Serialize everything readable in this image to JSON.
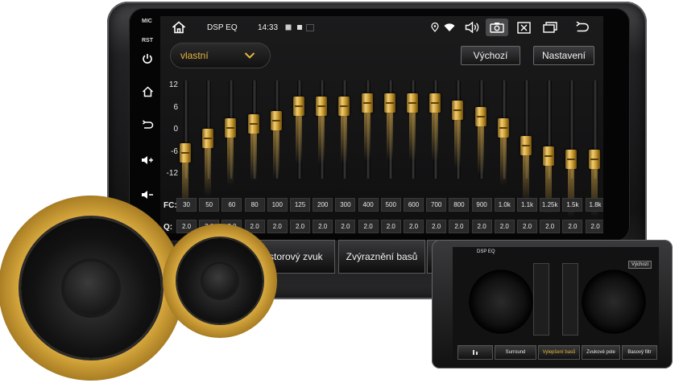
{
  "side_panel": {
    "mic_label": "MIC",
    "rst_label": "RST"
  },
  "statusbar": {
    "title": "DSP EQ",
    "time": "14:33"
  },
  "preset": {
    "label": "vlastní"
  },
  "buttons": {
    "default_label": "Výchozí",
    "settings_label": "Nastavení"
  },
  "eq": {
    "db_labels": [
      "12",
      "6",
      "0",
      "-6",
      "-12"
    ],
    "fc_label": "FC:",
    "q_label": "Q:",
    "frequencies": [
      "30",
      "50",
      "60",
      "80",
      "100",
      "125",
      "200",
      "300",
      "400",
      "500",
      "600",
      "700",
      "800",
      "900",
      "1.0k",
      "1.1k",
      "1.25k",
      "1.5k",
      "1.8k"
    ],
    "q_values": [
      "2.0",
      "2.0",
      "2.0",
      "2.0",
      "2.0",
      "2.0",
      "2.0",
      "2.0",
      "2.0",
      "2.0",
      "2.0",
      "2.0",
      "2.0",
      "2.0",
      "2.0",
      "2.0",
      "2.0",
      "2.0",
      "2.0"
    ],
    "gains_db": [
      -6,
      -2,
      1,
      2,
      3,
      7,
      7,
      7,
      8,
      8,
      8,
      8,
      6,
      4,
      1,
      -4,
      -7,
      -8,
      -8
    ]
  },
  "tabs": {
    "surround_label": "Prostorový zvuk",
    "bass_boost_label": "Zvýraznění basů"
  },
  "tablet": {
    "title": "DSP EQ",
    "default_label": "Výchozí",
    "tab_surround": "Surround",
    "tab_bass_boost": "Vylepšení basů",
    "tab_sound_field": "Zvukové pole",
    "tab_bass_filter": "Basový filtr"
  },
  "colors": {
    "accent": "#e7b53c",
    "gold": "#c89a2e",
    "screen_bg": "#141415"
  }
}
